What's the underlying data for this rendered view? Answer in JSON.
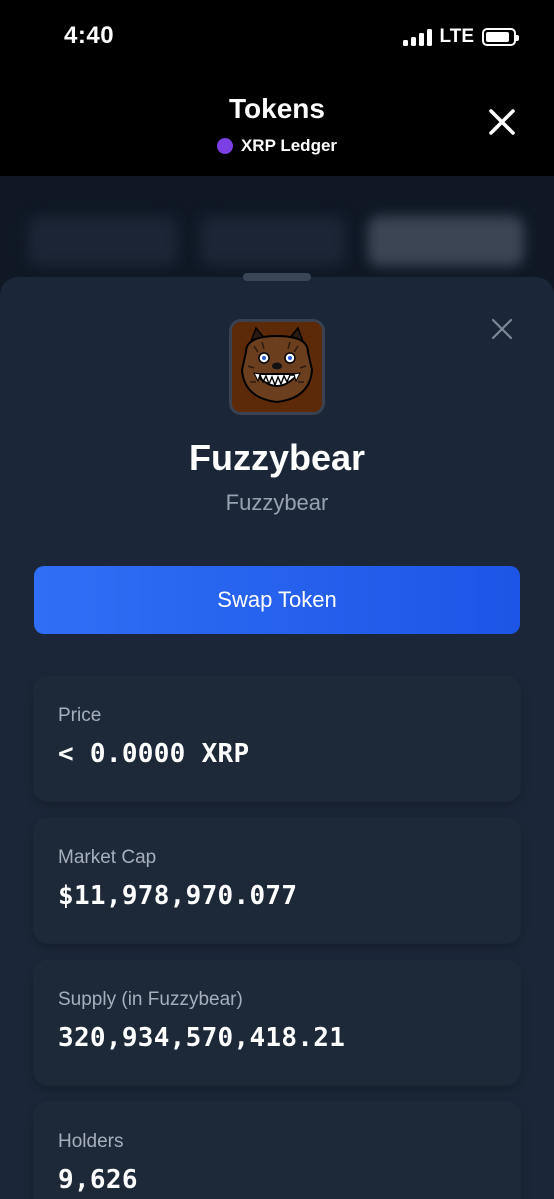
{
  "status_bar": {
    "time": "4:40",
    "network": "LTE",
    "battery_level": 0.9
  },
  "header": {
    "title": "Tokens",
    "chain_name": "XRP Ledger",
    "chain_color": "#7b3fe4",
    "close_icon": "close-icon"
  },
  "sheet": {
    "close_icon": "close-icon",
    "token": {
      "logo_icon": "fuzzybear-logo",
      "name": "Fuzzybear",
      "symbol": "Fuzzybear"
    },
    "swap_button_label": "Swap Token",
    "accent_color": "#2f6ff5",
    "stats": [
      {
        "label": "Price",
        "value": "< 0.0000 XRP"
      },
      {
        "label": "Market Cap",
        "value": "$11,978,970.077"
      },
      {
        "label": "Supply (in Fuzzybear)",
        "value": "320,934,570,418.21"
      },
      {
        "label": "Holders",
        "value": "9,626"
      }
    ]
  }
}
